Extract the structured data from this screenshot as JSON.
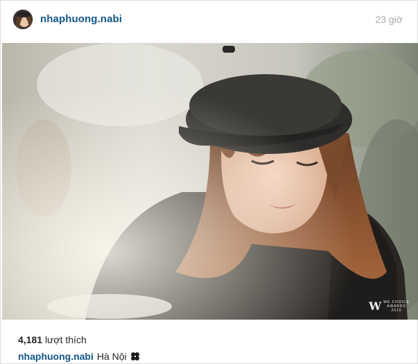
{
  "post": {
    "username": "nhaphuong.nabi",
    "time_ago": "23 giờ",
    "likes_count": "4,181",
    "likes_label": "lượt thích",
    "caption": {
      "author": "nhaphuong.nabi",
      "text": "Hà Nội"
    },
    "image_watermark": {
      "logo": "W",
      "text_line1": "WE CHOICE",
      "text_line2": "AWARDS",
      "text_line3": "2015"
    }
  }
}
